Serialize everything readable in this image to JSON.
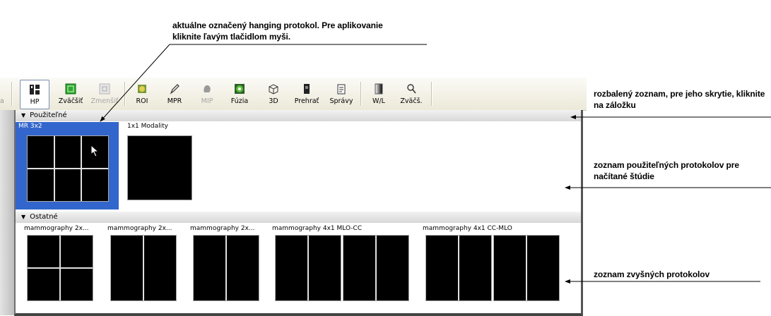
{
  "callouts": {
    "current_protocol": "aktuálne označený hanging protokol. Pre aplikovanie kliknite ľavým tlačidlom myši.",
    "expanded_list": "rozbalený zoznam, pre jeho skrytie, kliknite na záložku",
    "usable_list": "zoznam použiteľných protokolov pre načítané štúdie",
    "other_list": "zoznam zvyšných protokolov"
  },
  "toolbar": {
    "edge_label": "a",
    "hp": "HP",
    "zoom_in": "Zväčšiť",
    "zoom_out": "Zmenšiť",
    "roi": "ROI",
    "mpr": "MPR",
    "mip": "MIP",
    "fusion": "Fúzia",
    "three_d": "3D",
    "play": "Prehrať",
    "reports": "Správy",
    "wl": "W/L",
    "magnify": "Zväčš."
  },
  "groups": {
    "usable": "Použiteľné",
    "other": "Ostatné"
  },
  "usable_protocols": [
    {
      "name": "MR 3x2"
    },
    {
      "name": "1x1 Modality"
    }
  ],
  "other_protocols": [
    {
      "name": "mammography 2x..."
    },
    {
      "name": "mammography 2x..."
    },
    {
      "name": "mammography 2x..."
    },
    {
      "name": "mammography 4x1 MLO-CC"
    },
    {
      "name": "mammography 4x1 CC-MLO"
    }
  ],
  "colors": {
    "selection": "#3366cc",
    "zoom_icon": "#2ea82e"
  }
}
